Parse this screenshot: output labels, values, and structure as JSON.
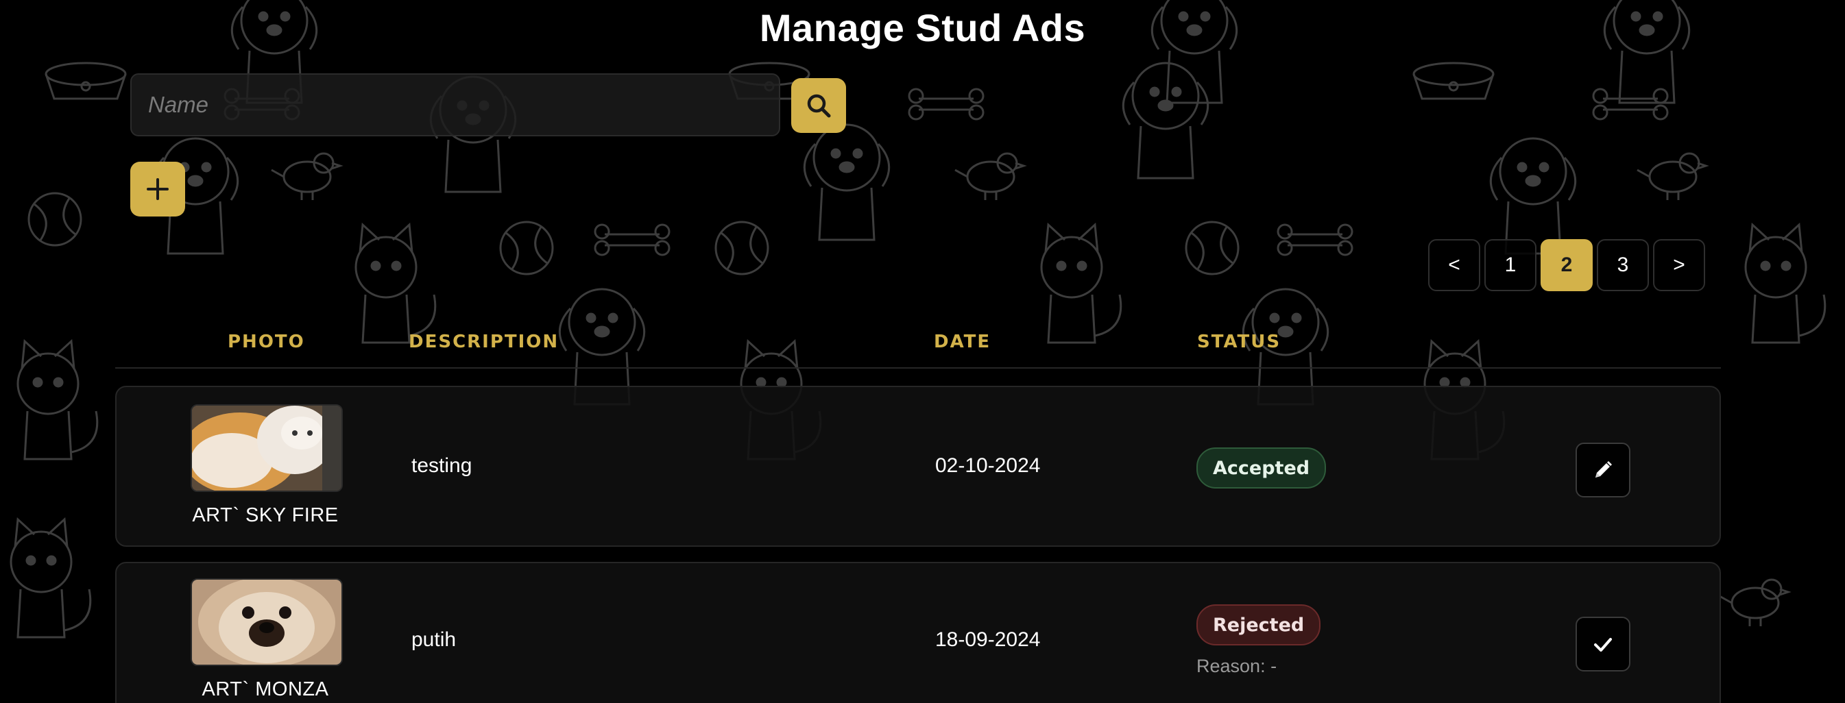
{
  "page": {
    "title": "Manage Stud Ads"
  },
  "search": {
    "placeholder": "Name",
    "value": ""
  },
  "pagination": {
    "prev_label": "<",
    "pages": [
      "1",
      "2",
      "3"
    ],
    "current": "2",
    "next_label": ">"
  },
  "table": {
    "headers": {
      "photo": "PHOTO",
      "description": "DESCRIPTION",
      "date": "DATE",
      "status": "STATUS"
    },
    "rows": [
      {
        "name": "ART` SKY FIRE",
        "description": "testing",
        "date": "02-10-2024",
        "status": "Accepted",
        "action_icon": "pencil-icon"
      },
      {
        "name": "ART` MONZA",
        "description": "putih",
        "date": "18-09-2024",
        "status": "Rejected",
        "reason": "Reason: -",
        "action_icon": "check-icon"
      }
    ]
  },
  "colors": {
    "accent": "#d3b24a",
    "background": "#000000",
    "accepted_bg": "#16301f",
    "rejected_bg": "#3b1818"
  },
  "icons": {
    "search": "search-icon",
    "add": "plus-icon"
  }
}
